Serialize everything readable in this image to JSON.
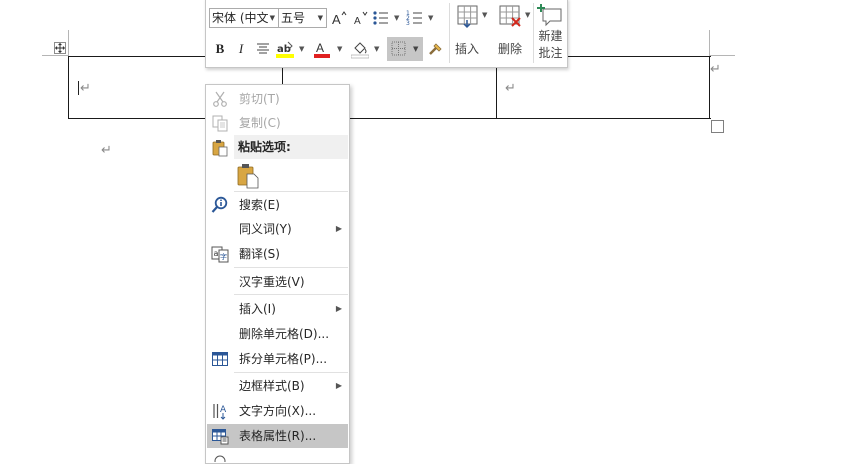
{
  "mini_toolbar": {
    "font_name": "宋体 (中文",
    "font_size": "五号",
    "bold": "B",
    "italic": "I",
    "insert_label": "插入",
    "delete_label": "删除",
    "new_comment_line1": "新建",
    "new_comment_line2": "批注",
    "colors": {
      "highlight": "#ffff00",
      "font_color": "#e02020"
    }
  },
  "context_menu": {
    "items": [
      {
        "label": "剪切(T)",
        "icon": "scissors-icon",
        "state": "disabled"
      },
      {
        "label": "复制(C)",
        "icon": "copy-icon",
        "state": "disabled"
      },
      {
        "label": "粘贴选项:",
        "icon": "paste-icon",
        "state": "header"
      },
      {
        "label": "搜索(E)",
        "icon": "search-icon"
      },
      {
        "label": "同义词(Y)",
        "icon": "",
        "submenu": true
      },
      {
        "label": "翻译(S)",
        "icon": "translate-icon"
      },
      {
        "label": "汉字重选(V)",
        "icon": ""
      },
      {
        "label": "插入(I)",
        "icon": "",
        "submenu": true
      },
      {
        "label": "删除单元格(D)...",
        "icon": ""
      },
      {
        "label": "拆分单元格(P)...",
        "icon": "split-cells-icon"
      },
      {
        "label": "边框样式(B)",
        "icon": "",
        "submenu": true
      },
      {
        "label": "文字方向(X)...",
        "icon": "text-direction-icon"
      },
      {
        "label": "表格属性(R)...",
        "icon": "table-properties-icon",
        "state": "highlighted"
      }
    ]
  }
}
